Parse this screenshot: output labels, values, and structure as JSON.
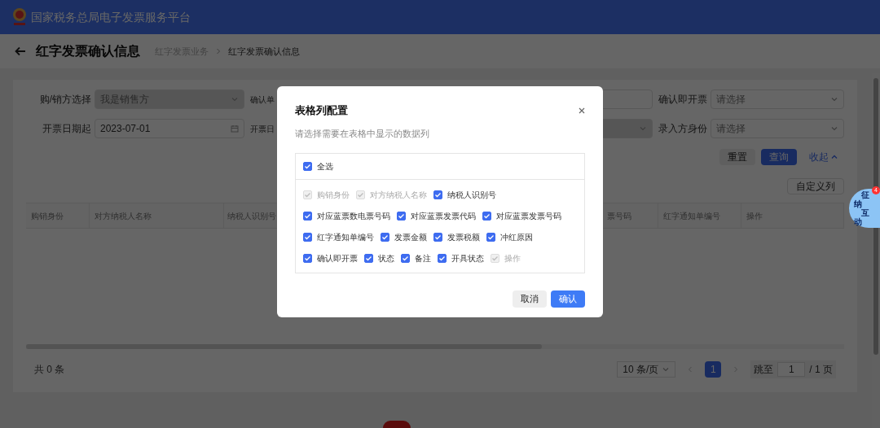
{
  "header": {
    "title": "国家税务总局电子发票服务平台"
  },
  "page": {
    "title": "红字发票确认信息",
    "breadcrumb": [
      "红字发票业务",
      "红字发票确认信息"
    ]
  },
  "filters": [
    {
      "label": "购/销方选择",
      "kind": "select",
      "placeholder": "我是销售方",
      "disabled": true
    },
    {
      "label": "确认单",
      "kind": "input",
      "disabled": false
    },
    {
      "label": "确认即开票",
      "kind": "select",
      "placeholder": "请选择",
      "disabled": false
    },
    {
      "label": "开票日期起",
      "kind": "date",
      "value": "2023-07-01",
      "disabled": false
    },
    {
      "label": "开票日",
      "kind": "select",
      "disabled": true
    },
    {
      "label": "录入方身份",
      "kind": "select",
      "placeholder": "请选择",
      "disabled": false
    }
  ],
  "actions": {
    "reset": "重置",
    "search": "查询",
    "collapse": "收起"
  },
  "customize_button": "自定义列",
  "table": {
    "columns": [
      "购销身份",
      "对方纳税人名称",
      "纳税人识别号",
      "票号码",
      "红字通知单编号",
      "操作"
    ]
  },
  "footer": {
    "total": "共 0 条",
    "page_size": "10 条/页",
    "pages": [
      {
        "label": "1",
        "selected": true
      }
    ],
    "jump_label": "跳至",
    "jump_value": "1",
    "page_count": "/ 1 页"
  },
  "dialog": {
    "title": "表格列配置",
    "hint": "请选择需要在表格中显示的数据列",
    "select_all": {
      "label": "全选",
      "checked": true
    },
    "options": [
      {
        "label": "购销身份",
        "checked": true,
        "disabled": true
      },
      {
        "label": "对方纳税人名称",
        "checked": true,
        "disabled": true
      },
      {
        "label": "纳税人识别号",
        "checked": true,
        "disabled": false
      },
      {
        "label": "对应蓝票数电票号码",
        "checked": true,
        "disabled": false
      },
      {
        "label": "对应蓝票发票代码",
        "checked": true,
        "disabled": false
      },
      {
        "label": "对应蓝票发票号码",
        "checked": true,
        "disabled": false
      },
      {
        "label": "红字通知单编号",
        "checked": true,
        "disabled": false
      },
      {
        "label": "发票金额",
        "checked": true,
        "disabled": false
      },
      {
        "label": "发票税额",
        "checked": true,
        "disabled": false
      },
      {
        "label": "冲红原因",
        "checked": true,
        "disabled": false
      },
      {
        "label": "确认即开票",
        "checked": true,
        "disabled": false
      },
      {
        "label": "状态",
        "checked": true,
        "disabled": false
      },
      {
        "label": "备注",
        "checked": true,
        "disabled": false
      },
      {
        "label": "开具状态",
        "checked": true,
        "disabled": false
      },
      {
        "label": "操作",
        "checked": true,
        "disabled": true
      }
    ],
    "buttons": {
      "cancel": "取消",
      "confirm": "确认"
    }
  },
  "assistant": {
    "label": [
      "征",
      "纳",
      "互",
      "动"
    ],
    "badge": "4"
  }
}
